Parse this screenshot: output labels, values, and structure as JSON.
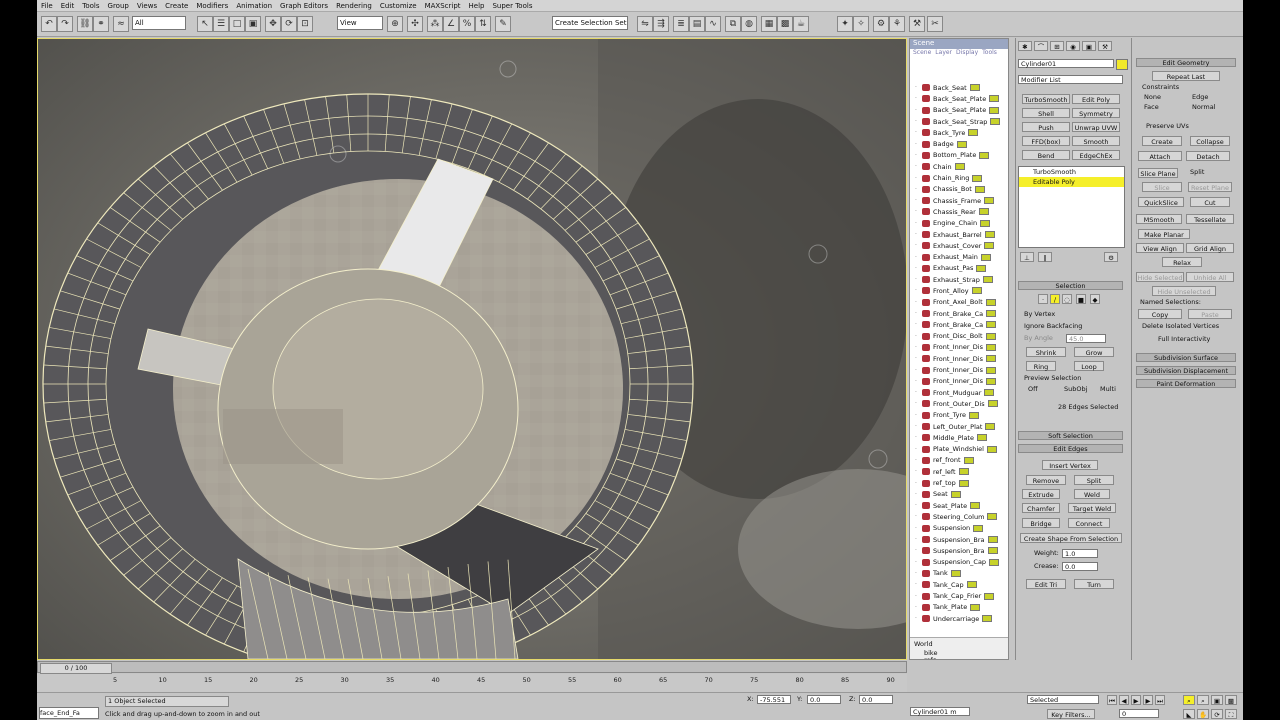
{
  "menu": [
    "File",
    "Edit",
    "Tools",
    "Group",
    "Views",
    "Create",
    "Modifiers",
    "Animation",
    "Graph Editors",
    "Rendering",
    "Customize",
    "MAXScript",
    "Help",
    "Super Tools"
  ],
  "toolbar": {
    "selection_filter": "All",
    "ref_coord": "View",
    "named_selection": "Create Selection Set"
  },
  "explorer": {
    "title": "Scene",
    "menu": [
      "Scene",
      "Layer",
      "Display",
      "Tools"
    ],
    "items": [
      "Back_Seat",
      "Back_Seat_Plate",
      "Back_Seat_Plate",
      "Back_Seat_Strap",
      "Back_Tyre",
      "Badge",
      "Bottom_Plate",
      "Chain",
      "Chain_Ring",
      "Chassis_Bot",
      "Chassis_Frame",
      "Chassis_Rear",
      "Engine_Chain",
      "Exhaust_Barrel",
      "Exhaust_Cover",
      "Exhaust_Main",
      "Exhaust_Pas",
      "Exhaust_Strap",
      "Front_Alloy",
      "Front_Axel_Bolt",
      "Front_Brake_Ca",
      "Front_Brake_Ca",
      "Front_Disc_Bolt",
      "Front_Inner_Dis",
      "Front_Inner_Dis",
      "Front_Inner_Dis",
      "Front_Inner_Dis",
      "Front_Mudguar",
      "Front_Outer_Dis",
      "Front_Tyre",
      "Left_Outer_Plat",
      "Middle_Plate",
      "Plate_Windshiel",
      "ref_front",
      "ref_left",
      "ref_top",
      "Seat",
      "Seat_Plate",
      "Steering_Colum",
      "Suspension",
      "Suspension_Bra",
      "Suspension_Bra",
      "Suspension_Cap",
      "Tank",
      "Tank_Cap",
      "Tank_Cap_Frier",
      "Tank_Plate",
      "Undercarriage"
    ],
    "bottom_world": "World",
    "bottom_items": [
      "bike",
      "refs"
    ]
  },
  "command_panel": {
    "object_name": "Cylinder01",
    "modifier_list": "Modifier List",
    "buttons": [
      "TurboSmooth",
      "Edit Poly",
      "Shell",
      "Symmetry",
      "Push",
      "Unwrap UVW",
      "FFD(box)",
      "Smooth",
      "Bend",
      "EdgeChEx"
    ],
    "stack": [
      "TurboSmooth",
      "Editable Poly"
    ],
    "selection_header": "Selection",
    "by_vertex": "By Vertex",
    "ignore_backfacing": "Ignore Backfacing",
    "by_angle": "By Angle",
    "angle_value": "45.0",
    "shrink": "Shrink",
    "grow": "Grow",
    "ring": "Ring",
    "loop": "Loop",
    "preview_selection": "Preview Selection",
    "preview_opts": [
      "Off",
      "SubObj",
      "Multi"
    ],
    "selected_count": "28 Edges Selected",
    "soft_selection": "Soft Selection",
    "edit_edges": "Edit Edges",
    "insert_vertex": "Insert Vertex",
    "remove": "Remove",
    "split": "Split",
    "extrude": "Extrude",
    "weld": "Weld",
    "chamfer": "Chamfer",
    "target_weld": "Target Weld",
    "bridge": "Bridge",
    "connect": "Connect",
    "create_shape": "Create Shape From Selection",
    "weight_label": "Weight:",
    "weight_value": "1.0",
    "crease_label": "Crease:",
    "crease_value": "0.0",
    "edit_tri": "Edit Tri",
    "turn": "Turn"
  },
  "graphite": {
    "edit_geometry": "Edit Geometry",
    "repeat_last": "Repeat Last",
    "constraints": "Constraints",
    "none": "None",
    "edge": "Edge",
    "face": "Face",
    "normal": "Normal",
    "preserve_uvs": "Preserve UVs",
    "create": "Create",
    "collapse": "Collapse",
    "attach": "Attach",
    "detach": "Detach",
    "slice_plane": "Slice Plane",
    "split": "Split",
    "slice": "Slice",
    "reset_plane": "Reset Plane",
    "quickslice": "QuickSlice",
    "cut": "Cut",
    "msmooth": "MSmooth",
    "tessellate": "Tessellate",
    "make_planar": "Make Planar",
    "view_align": "View Align",
    "grid_align": "Grid Align",
    "relax": "Relax",
    "hide_selected": "Hide Selected",
    "unhide_all": "Unhide All",
    "hide_unselected": "Hide Unselected",
    "named_selections": "Named Selections:",
    "copy": "Copy",
    "paste": "Paste",
    "delete_isolated": "Delete Isolated Vertices",
    "full_interactivity": "Full Interactivity",
    "subdivision_surface": "Subdivision Surface",
    "subdivision_displacement": "Subdivision Displacement",
    "paint_deformation": "Paint Deformation"
  },
  "timeline": {
    "frame": "0 / 100",
    "ticks": [
      "5",
      "10",
      "15",
      "20",
      "25",
      "30",
      "35",
      "40",
      "45",
      "50",
      "55",
      "60",
      "65",
      "70",
      "75",
      "80",
      "85",
      "90"
    ]
  },
  "status": {
    "selected": "1 Object Selected",
    "prompt": "Click and drag up-and-down to zoom in and out",
    "x_label": "X:",
    "x_value": "-75.551",
    "y_label": "Y:",
    "y_value": "0.0",
    "z_label": "Z:",
    "z_value": "0.0",
    "key_mode": "Selected",
    "key_filters": "Key Filters...",
    "frame_field": "0",
    "script_label": "face_End_Fa",
    "cylinder_label": "Cylinder01 m"
  }
}
